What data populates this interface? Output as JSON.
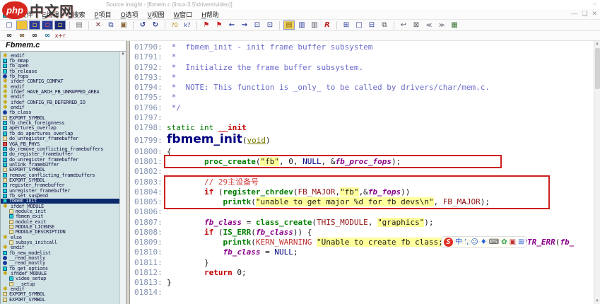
{
  "watermark": {
    "badge": "php",
    "brand": "中文网"
  },
  "window": {
    "title": "Source Insight - [fbmem.c (linux-3.5\\drivers\\video)]",
    "title_ctrl": "¬",
    "mdi_controls": [
      "—",
      "❏",
      "✕"
    ]
  },
  "menu": {
    "items": [
      "F文件",
      "E编辑",
      "S搜索",
      "P项目",
      "O选项",
      "V视图",
      "W窗口",
      "H帮助"
    ]
  },
  "toolbar": {
    "row1": [
      [
        {
          "n": "new-file",
          "g": "▢",
          "fg": "#2a3a9a"
        },
        {
          "n": "open-file",
          "g": "",
          "bg": "#f0c23a"
        },
        {
          "n": "save-file",
          "g": "▫",
          "fg": "#ffe040",
          "bg": "#2a3a9a"
        },
        {
          "n": "save-as",
          "g": "▫",
          "fg": "#ff6050",
          "bg": "#2a3a9a"
        },
        {
          "n": "save-all",
          "g": "▫",
          "fg": "#ffe040",
          "bg": "#1a2a7a"
        }
      ],
      [
        {
          "n": "print",
          "g": "▤",
          "fg": "#777"
        }
      ],
      [
        {
          "n": "cut",
          "g": "✕",
          "fg": "#703030",
          "bd": 1
        },
        {
          "n": "copy",
          "g": "⧉",
          "fg": "#2a3a9a"
        },
        {
          "n": "paste",
          "g": "▣",
          "fg": "#8a6a3a"
        }
      ],
      [
        {
          "n": "undo",
          "g": "↺",
          "fg": "#2a3a9a",
          "bd": 1
        },
        {
          "n": "redo",
          "g": "↻",
          "fg": "#2a3a9a",
          "bd": 1
        }
      ],
      [
        {
          "n": "search-replace",
          "g": "?0",
          "fg": "#b8860b",
          "sm": 1
        },
        {
          "n": "context-help",
          "g": "k?",
          "fg": "#2a3a9a",
          "sm": 1
        }
      ],
      [
        {
          "n": "bookmark-set",
          "g": "⚑",
          "fg": "#cc2020"
        },
        {
          "n": "bookmark-next",
          "g": "⚑",
          "fg": "#cc2020"
        },
        {
          "n": "nav-back",
          "g": "←",
          "fg": "#2a3a9a",
          "bd": 1
        },
        {
          "n": "nav-forward",
          "g": "→",
          "fg": "#2a3a9a",
          "bd": 1
        },
        {
          "n": "goto-prev-link",
          "g": "⊡",
          "fg": "#2a3a9a"
        },
        {
          "n": "goto-next-link",
          "g": "⊡",
          "fg": "#2a3a9a"
        }
      ],
      [
        {
          "n": "symbol-window",
          "g": "▤",
          "fg": "#8a6a10",
          "bg": "#f0d060"
        },
        {
          "n": "relation-window",
          "g": "▥",
          "fg": "#2a3a9a"
        },
        {
          "n": "lookup-references",
          "g": "▥",
          "fg": "#556"
        },
        {
          "n": "reference-tool",
          "g": "R",
          "fg": "#c02020",
          "it": 1,
          "bd": 1
        }
      ],
      [
        {
          "n": "tile-four-windows",
          "g": "⊞",
          "fg": "#2a3a9a"
        },
        {
          "n": "maximize-window",
          "g": "□",
          "fg": "#2a3a9a"
        },
        {
          "n": "tile-horizontal",
          "g": "⊟",
          "fg": "#2a3a9a"
        },
        {
          "n": "cascade-windows",
          "g": "⧉",
          "fg": "#556"
        }
      ],
      [
        {
          "n": "link-back",
          "g": "↩",
          "fg": "#556"
        },
        {
          "n": "select-block",
          "g": "⊠",
          "fg": "#556"
        },
        {
          "n": "prev-result",
          "g": "≪",
          "fg": "#556",
          "sm": 1
        },
        {
          "n": "next-result",
          "g": "≫",
          "fg": "#556",
          "sm": 1
        },
        {
          "n": "color-format",
          "g": "▦",
          "fg": "#3a7a3a"
        }
      ]
    ],
    "row2": [
      [
        {
          "n": "search",
          "g": "∞",
          "fg": "#222",
          "bd": 1
        },
        {
          "n": "search-project",
          "g": "∞",
          "fg": "#5a3a10",
          "bd": 1
        },
        {
          "n": "search-files",
          "g": "∞",
          "fg": "#222",
          "bd": 1
        },
        {
          "n": "search-context",
          "g": "∞",
          "fg": "#1a6a8a",
          "bd": 1
        },
        {
          "n": "search-and-replace",
          "g": "x+r",
          "fg": "#8a2020",
          "sm": 1
        }
      ]
    ]
  },
  "sidebar": {
    "filename": "Fbmem.c",
    "scroll_up_arrow": "▲",
    "items": [
      {
        "l": "endif",
        "t": "pp"
      },
      {
        "l": "fb_mmap",
        "t": "fn"
      },
      {
        "l": "fb_open",
        "t": "fn"
      },
      {
        "l": "fb_release",
        "t": "fn"
      },
      {
        "l": "fb_fops",
        "t": "var"
      },
      {
        "l": "ifdef CONFIG_COMPAT",
        "t": "pp"
      },
      {
        "l": "endif",
        "t": "pp"
      },
      {
        "l": "ifdef HAVE_ARCH_FB_UNMAPPED_AREA",
        "t": "pp"
      },
      {
        "l": "endif",
        "t": "pp"
      },
      {
        "l": "ifdef CONFIG_FB_DEFERRED_IO",
        "t": "pp"
      },
      {
        "l": "endif",
        "t": "pp"
      },
      {
        "l": "fb_class",
        "t": "var"
      },
      {
        "l": "EXPORT_SYMBOL",
        "t": "mac"
      },
      {
        "l": "fb_check_foreignness",
        "t": "fn"
      },
      {
        "l": "apertures_overlap",
        "t": "fn"
      },
      {
        "l": "fb_do_apertures_overlap",
        "t": "fn"
      },
      {
        "l": "do_unregister_framebuffer",
        "t": "mac"
      },
      {
        "l": "VGA_FB_PHYS",
        "t": "def"
      },
      {
        "l": "do_remove_conflicting_framebuffers",
        "t": "fn"
      },
      {
        "l": "do_register_framebuffer",
        "t": "fn"
      },
      {
        "l": "do_unregister_framebuffer",
        "t": "fn"
      },
      {
        "l": "unlink_framebuffer",
        "t": "fn"
      },
      {
        "l": "EXPORT_SYMBOL",
        "t": "mac"
      },
      {
        "l": "remove_conflicting_framebuffers",
        "t": "fn"
      },
      {
        "l": "EXPORT_SYMBOL",
        "t": "mac"
      },
      {
        "l": "register_framebuffer",
        "t": "fn"
      },
      {
        "l": "unregister_framebuffer",
        "t": "fn"
      },
      {
        "l": "fb_set_suspend",
        "t": "fn"
      },
      {
        "l": "fbmem_init",
        "t": "fn",
        "sel": true
      },
      {
        "l": "ifdef MODULE",
        "t": "pp"
      },
      {
        "l": "module_init",
        "t": "mac",
        "i": 1
      },
      {
        "l": "fbmem_exit",
        "t": "fn",
        "i": 1
      },
      {
        "l": "module_exit",
        "t": "mac",
        "i": 1
      },
      {
        "l": "MODULE_LICENSE",
        "t": "mac",
        "i": 1
      },
      {
        "l": "MODULE_DESCRIPTION",
        "t": "mac",
        "i": 1
      },
      {
        "l": "else",
        "t": "pp"
      },
      {
        "l": "subsys_initcall",
        "t": "mac",
        "i": 1
      },
      {
        "l": "endif",
        "t": "pp"
      },
      {
        "l": "fb_new_modelist",
        "t": "fn"
      },
      {
        "l": "__read_mostly",
        "t": "var"
      },
      {
        "l": "__read_mostly",
        "t": "var"
      },
      {
        "l": "fb_get_options",
        "t": "fn"
      },
      {
        "l": "ifndef MODULE",
        "t": "pp"
      },
      {
        "l": "video_setup",
        "t": "fn",
        "i": 1
      },
      {
        "l": "__setup",
        "t": "mac",
        "i": 1
      },
      {
        "l": "endif",
        "t": "pp"
      },
      {
        "l": "EXPORT_SYMBOL",
        "t": "mac"
      },
      {
        "l": "EXPORT_SYMBOL",
        "t": "mac"
      }
    ]
  },
  "code": {
    "lines": [
      {
        "no": "01790:",
        "segs": [
          {
            "t": " *  fbmem_init - init frame buffer subsystem",
            "c": "cm"
          }
        ]
      },
      {
        "no": "01791:",
        "segs": [
          {
            "t": " *",
            "c": "cm"
          }
        ]
      },
      {
        "no": "01792:",
        "segs": [
          {
            "t": " *  Initialize the frame buffer subsystem.",
            "c": "cm"
          }
        ]
      },
      {
        "no": "01793:",
        "segs": [
          {
            "t": " *",
            "c": "cm"
          }
        ]
      },
      {
        "no": "01794:",
        "segs": [
          {
            "t": " *  NOTE: This function is _only_ to be called by drivers/char/mem.c.",
            "c": "cm"
          }
        ]
      },
      {
        "no": "01795:",
        "segs": [
          {
            "t": " *",
            "c": "cm"
          }
        ]
      },
      {
        "no": "01796:",
        "segs": [
          {
            "t": " */",
            "c": "cm"
          }
        ]
      },
      {
        "no": "01797:",
        "segs": []
      },
      {
        "no": "01798:",
        "segs": [
          {
            "t": "static int ",
            "c": "kg"
          },
          {
            "t": "__init",
            "c": "kr"
          }
        ]
      },
      {
        "no": "01799:",
        "big": true,
        "segs": [
          {
            "t": "fbmem_init",
            "c": "bg"
          },
          {
            "t": "(",
            "c": "pl"
          },
          {
            "t": "void",
            "c": "vd"
          },
          {
            "t": ")",
            "c": "pl"
          }
        ]
      },
      {
        "no": "01800:",
        "segs": [
          {
            "t": "{",
            "c": "pl"
          }
        ]
      },
      {
        "no": "01801:",
        "segs": [
          {
            "t": "        ",
            "c": "pl"
          },
          {
            "t": "proc_create",
            "c": "fn"
          },
          {
            "t": "(",
            "c": "pl"
          },
          {
            "t": "\"fb\"",
            "c": "st"
          },
          {
            "t": ", 0, ",
            "c": "pl"
          },
          {
            "t": "NULL",
            "c": "nu"
          },
          {
            "t": ", &",
            "c": "pl"
          },
          {
            "t": "fb_proc_fops",
            "c": "vr"
          },
          {
            "t": ");",
            "c": "pl"
          }
        ]
      },
      {
        "no": "01802:",
        "segs": []
      },
      {
        "no": "01803:",
        "segs": [
          {
            "t": "        ",
            "c": "pl"
          },
          {
            "t": "// 29主设备号",
            "c": "cc"
          }
        ]
      },
      {
        "no": "01804:",
        "segs": [
          {
            "t": "        ",
            "c": "pl"
          },
          {
            "t": "if",
            "c": "kr"
          },
          {
            "t": " (",
            "c": "pl"
          },
          {
            "t": "register_chrdev",
            "c": "fn"
          },
          {
            "t": "(",
            "c": "pl"
          },
          {
            "t": "FB_MAJOR",
            "c": "mc"
          },
          {
            "t": ",",
            "c": "pl"
          },
          {
            "t": "\"fb\"",
            "c": "st"
          },
          {
            "t": ",&",
            "c": "pl"
          },
          {
            "t": "fb_fops",
            "c": "vr"
          },
          {
            "t": "))",
            "c": "pl"
          }
        ]
      },
      {
        "no": "01805:",
        "segs": [
          {
            "t": "            ",
            "c": "pl"
          },
          {
            "t": "printk",
            "c": "fn"
          },
          {
            "t": "(",
            "c": "pl"
          },
          {
            "t": "\"unable to get major %d for fb devs\\n\"",
            "c": "st"
          },
          {
            "t": ", ",
            "c": "pl"
          },
          {
            "t": "FB_MAJOR",
            "c": "mc"
          },
          {
            "t": ");",
            "c": "pl"
          }
        ]
      },
      {
        "no": "01806:",
        "segs": []
      },
      {
        "no": "01807:",
        "segs": [
          {
            "t": "        ",
            "c": "pl"
          },
          {
            "t": "fb_class",
            "c": "vr"
          },
          {
            "t": " = ",
            "c": "pl"
          },
          {
            "t": "class_create",
            "c": "fn"
          },
          {
            "t": "(",
            "c": "pl"
          },
          {
            "t": "THIS_MODULE",
            "c": "mc"
          },
          {
            "t": ", ",
            "c": "pl"
          },
          {
            "t": "\"graphics\"",
            "c": "st"
          },
          {
            "t": ");",
            "c": "pl"
          }
        ]
      },
      {
        "no": "01808:",
        "segs": [
          {
            "t": "        ",
            "c": "pl"
          },
          {
            "t": "if",
            "c": "kr"
          },
          {
            "t": " (",
            "c": "pl"
          },
          {
            "t": "IS_ERR",
            "c": "fn"
          },
          {
            "t": "(",
            "c": "pl"
          },
          {
            "t": "fb_class",
            "c": "vr"
          },
          {
            "t": ")) {",
            "c": "pl"
          }
        ]
      },
      {
        "no": "01809:",
        "segs": [
          {
            "t": "            ",
            "c": "pl"
          },
          {
            "t": "printk",
            "c": "fn"
          },
          {
            "t": "(",
            "c": "pl"
          },
          {
            "t": "KERN_WARNING",
            "c": "rd"
          },
          {
            "t": " ",
            "c": "pl"
          },
          {
            "t": "\"Unable to create fb class; errno = %ld\\n\"",
            "c": "st"
          },
          {
            "t": ", ",
            "c": "pl"
          },
          {
            "t": "PTR_ERR",
            "c": "vr"
          },
          {
            "t": "(",
            "c": "pl"
          },
          {
            "t": "fb_",
            "c": "vr"
          }
        ]
      },
      {
        "no": "01810:",
        "segs": [
          {
            "t": "            ",
            "c": "pl"
          },
          {
            "t": "fb_class",
            "c": "vr"
          },
          {
            "t": " = ",
            "c": "pl"
          },
          {
            "t": "NULL",
            "c": "nu"
          },
          {
            "t": ";",
            "c": "pl"
          }
        ]
      },
      {
        "no": "01811:",
        "segs": [
          {
            "t": "        }",
            "c": "pl"
          }
        ]
      },
      {
        "no": "01812:",
        "segs": [
          {
            "t": "        ",
            "c": "pl"
          },
          {
            "t": "return",
            "c": "kr"
          },
          {
            "t": " 0;",
            "c": "pl"
          }
        ]
      },
      {
        "no": "01813:",
        "segs": [
          {
            "t": "}",
            "c": "pl"
          }
        ]
      },
      {
        "no": "01814:",
        "segs": []
      }
    ]
  },
  "ime": {
    "logo": "S",
    "icons": [
      {
        "n": "ime-mode-chinese",
        "g": "中",
        "fg": "#2a62d8"
      },
      {
        "n": "ime-punctuation",
        "g": "’,",
        "fg": "#2a62d8"
      },
      {
        "n": "ime-emoji",
        "g": "☺",
        "fg": "#2a62d8"
      },
      {
        "n": "ime-voice",
        "g": "♦",
        "fg": "#2a62d8"
      },
      {
        "n": "ime-keyboard",
        "g": "⌨",
        "fg": "#4a4a4a"
      },
      {
        "n": "ime-skin",
        "g": "✿",
        "fg": "#3aa04a"
      },
      {
        "n": "ime-toolbox",
        "g": "▣",
        "fg": "#c03030"
      },
      {
        "n": "ime-more",
        "g": "⊞",
        "fg": "#2a62d8"
      }
    ]
  }
}
